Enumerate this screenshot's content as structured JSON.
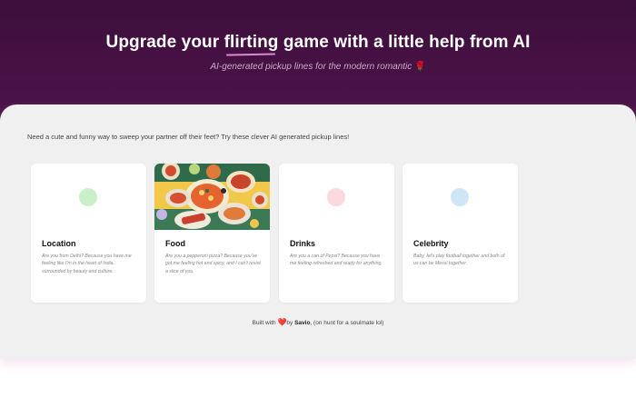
{
  "hero": {
    "title_before": "Upgrade your ",
    "title_highlight": "flirting",
    "title_after": " game with a little help from AI",
    "subtitle": "AI-generated pickup lines for the modern romantic",
    "subtitle_emoji": "🌹"
  },
  "intro": "Need a cute and funny way to sweep your partner off their feet? Try these clever AI generated pickup lines!",
  "cards": [
    {
      "title": "Location",
      "description": "Are you from Delhi? Because you have me feeling like I'm in the heart of India, surrounded by beauty and culture.",
      "dot_color": "#c9f0c9"
    },
    {
      "title": "Food",
      "description": "Are you a pepperoni pizza? Because you've got me feeling hot and spicy, and I can't resist a slice of you.",
      "image": "food-illustration"
    },
    {
      "title": "Drinks",
      "description": "Are you a can of Pepsi? Because you have me feeling refreshed and ready for anything.",
      "dot_color": "#fbd9de"
    },
    {
      "title": "Celebrity",
      "description": "Baby, let's play football together and both of us can be Messi together.",
      "dot_color": "#cfe6f7"
    }
  ],
  "footer": {
    "built_with": "Built with",
    "heart": "❤️",
    "by": "by",
    "author": "Savio",
    "tail": ", (on hunt for a soulmate lol)"
  }
}
